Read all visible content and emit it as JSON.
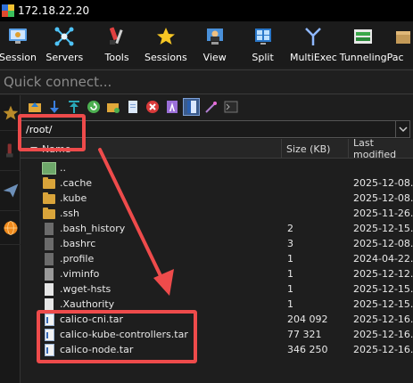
{
  "window": {
    "title": "172.18.22.20"
  },
  "toolbar": {
    "items": [
      {
        "label": "Session",
        "icon": "session-icon"
      },
      {
        "label": "Servers",
        "icon": "servers-icon"
      },
      {
        "label": "Tools",
        "icon": "tools-icon"
      },
      {
        "label": "Sessions",
        "icon": "sessions-star-icon"
      },
      {
        "label": "View",
        "icon": "view-icon"
      },
      {
        "label": "Split",
        "icon": "split-icon"
      },
      {
        "label": "MultiExec",
        "icon": "multiexec-icon"
      },
      {
        "label": "Tunneling",
        "icon": "tunneling-icon"
      },
      {
        "label": "Pac",
        "icon": "packages-icon"
      }
    ]
  },
  "quick_connect": {
    "placeholder": "Quick connect..."
  },
  "file_browser": {
    "path": "/root/",
    "columns": {
      "name": "Name",
      "size": "Size (KB)",
      "modified": "Last modified"
    },
    "rows": [
      {
        "name": "..",
        "size": "",
        "modified": "",
        "icon": "parent-folder-icon"
      },
      {
        "name": ".cache",
        "size": "",
        "modified": "2025-12-08...",
        "icon": "folder-icon"
      },
      {
        "name": ".kube",
        "size": "",
        "modified": "2025-12-08...",
        "icon": "folder-icon"
      },
      {
        "name": ".ssh",
        "size": "",
        "modified": "2025-11-26...",
        "icon": "folder-icon"
      },
      {
        "name": ".bash_history",
        "size": "2",
        "modified": "2025-12-15...",
        "icon": "file-icon"
      },
      {
        "name": ".bashrc",
        "size": "3",
        "modified": "2025-12-08...",
        "icon": "file-icon"
      },
      {
        "name": ".profile",
        "size": "1",
        "modified": "2024-04-22...",
        "icon": "file-icon"
      },
      {
        "name": ".viminfo",
        "size": "1",
        "modified": "2025-12-12...",
        "icon": "file-icon"
      },
      {
        "name": ".wget-hsts",
        "size": "1",
        "modified": "2025-12-15...",
        "icon": "file-icon"
      },
      {
        "name": ".Xauthority",
        "size": "1",
        "modified": "2025-12-15...",
        "icon": "file-icon"
      },
      {
        "name": "calico-cni.tar",
        "size": "204 092",
        "modified": "2025-12-16...",
        "icon": "tar-file-icon"
      },
      {
        "name": "calico-kube-controllers.tar",
        "size": "77 321",
        "modified": "2025-12-16...",
        "icon": "tar-file-icon"
      },
      {
        "name": "calico-node.tar",
        "size": "346 250",
        "modified": "2025-12-16...",
        "icon": "tar-file-icon"
      }
    ]
  },
  "colors": {
    "highlight": "#ee4b4b",
    "folder": "#d9a43a",
    "accent": "#3b5b8c"
  }
}
